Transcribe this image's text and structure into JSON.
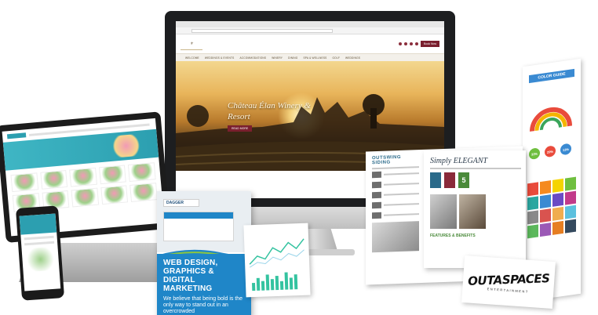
{
  "imac": {
    "nav_items": [
      "WELCOME",
      "WEDDINGS & EVENTS",
      "ACCOMMODATIONS",
      "WINERY",
      "DINING",
      "SPA & WELLNESS",
      "GOLF",
      "WEDDINGS"
    ],
    "book_label": "Book Now",
    "hero_title": "Château Élan Winery & Resort",
    "hero_button": "READ MORE"
  },
  "brochure": {
    "heading": "OUTSWING SIDING",
    "tagline": "Simply ELEGANT",
    "features_label": "FEATURES & BENEFITS",
    "badge_number": "5"
  },
  "banner": {
    "title": "COLOR GUIDE",
    "stats": [
      "33%",
      "29%",
      "13%"
    ]
  },
  "webdesign": {
    "brand": "DAGGER",
    "headline": "WEB DESIGN, GRAPHICS & DIGITAL MARKETING",
    "body": "We believe that being bold is the only way to stand out in an overcrowded"
  },
  "logo": {
    "word": "OUTASPACES",
    "sub": "ENTERTAINMENT"
  },
  "colors": {
    "wine": "#7a1f2e",
    "teal": "#2c9fb0",
    "blue": "#1f86c8",
    "green": "#4a8a3a"
  }
}
